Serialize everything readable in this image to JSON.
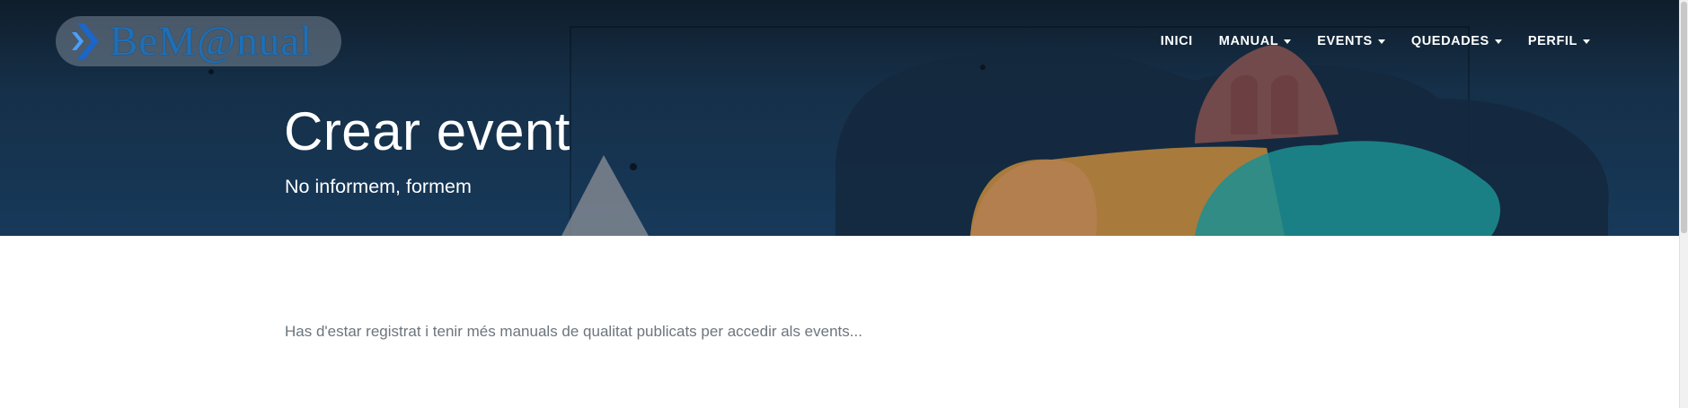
{
  "header": {
    "logo_text": "BeM@nual",
    "nav": [
      {
        "label": "INICI",
        "has_dropdown": false
      },
      {
        "label": "MANUAL",
        "has_dropdown": true
      },
      {
        "label": "EVENTS",
        "has_dropdown": true
      },
      {
        "label": "QUEDADES",
        "has_dropdown": true
      },
      {
        "label": "PERFIL",
        "has_dropdown": true
      }
    ]
  },
  "hero": {
    "title": "Crear event",
    "subtitle": "No informem, formem"
  },
  "main": {
    "notice": "Has d'estar registrat i tenir més manuals de qualitat publicats per accedir als events..."
  },
  "colors": {
    "hero_bg": "#17395a",
    "logo_text": "#1f6fb6",
    "notice_text": "#6c757d"
  }
}
